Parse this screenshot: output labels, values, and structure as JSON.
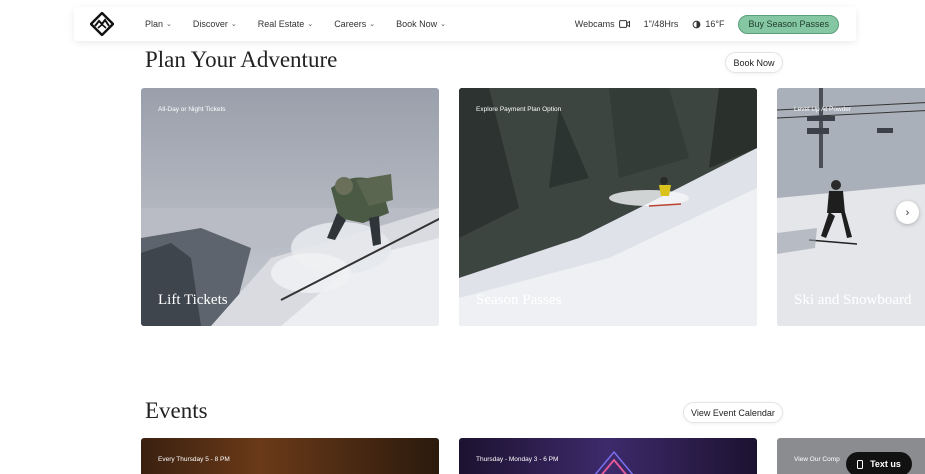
{
  "header": {
    "nav": [
      {
        "label": "Plan"
      },
      {
        "label": "Discover"
      },
      {
        "label": "Real Estate"
      },
      {
        "label": "Careers"
      },
      {
        "label": "Book Now"
      }
    ],
    "webcams_label": "Webcams",
    "snow_label": "1\"/48Hrs",
    "temp_label": "16°F",
    "buy_label": "Buy Season Passes"
  },
  "adventure": {
    "title": "Plan Your Adventure",
    "book_label": "Book Now",
    "cards": [
      {
        "tag": "All-Day or Night Tickets",
        "title": "Lift Tickets"
      },
      {
        "tag": "Explore Payment Plan Option",
        "title": "Season Passes"
      },
      {
        "tag": "Level Up At Powder",
        "title": "Ski and Snowboard"
      }
    ]
  },
  "events": {
    "title": "Events",
    "calendar_label": "View Event Calendar",
    "cards": [
      {
        "tag": "Every Thursday 5 - 8 PM"
      },
      {
        "tag": "Thursday - Monday 3 - 6 PM"
      },
      {
        "tag": "View Our Comp"
      }
    ]
  },
  "chat": {
    "label": "Text us"
  },
  "colors": {
    "accent": "#86c7a3"
  }
}
